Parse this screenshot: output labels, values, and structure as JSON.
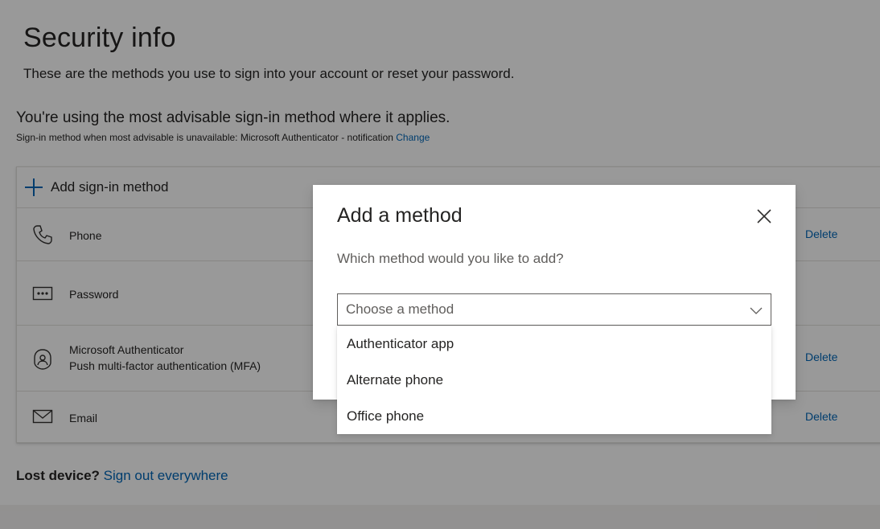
{
  "header": {
    "title": "Security info",
    "subtitle": "These are the methods you use to sign into your account or reset your password."
  },
  "advisable": {
    "status": "You're using the most advisable sign-in method where it applies.",
    "fallback_text": "Sign-in method when most advisable is unavailable: Microsoft Authenticator - notification ",
    "change_link": "Change"
  },
  "methods": {
    "add_label": "Add sign-in method",
    "items": [
      {
        "icon": "phone-icon",
        "name": "Phone",
        "delete": "Delete"
      },
      {
        "icon": "password-icon",
        "name": "Password"
      },
      {
        "icon": "authenticator-icon",
        "name": "Microsoft Authenticator",
        "detail": "Push multi-factor authentication (MFA)",
        "delete": "Delete"
      },
      {
        "icon": "email-icon",
        "name": "Email",
        "delete": "Delete"
      }
    ]
  },
  "footer": {
    "lost_device": "Lost device?",
    "sign_out_link": "Sign out everywhere"
  },
  "dialog": {
    "title": "Add a method",
    "question": "Which method would you like to add?",
    "select_placeholder": "Choose a method",
    "options": [
      "Authenticator app",
      "Alternate phone",
      "Office phone"
    ]
  },
  "colors": {
    "accent": "#0067b8",
    "text": "#252423",
    "overlay": "rgba(0,0,0,0.40)"
  }
}
